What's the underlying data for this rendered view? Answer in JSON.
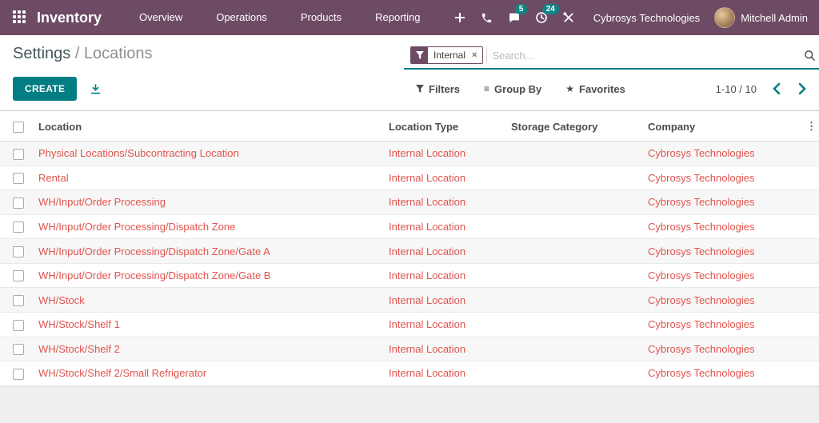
{
  "colors": {
    "brand": "#6e4b64",
    "accent": "#017e84",
    "badge": "#0c8586",
    "record": "#e0544e",
    "breadcrumb": "#44565c"
  },
  "navbar": {
    "app_name": "Inventory",
    "menus": [
      "Overview",
      "Operations",
      "Products",
      "Reporting"
    ],
    "message_badge": "5",
    "activity_badge": "24",
    "company": "Cybrosys Technologies",
    "user": "Mitchell Admin"
  },
  "breadcrumb": {
    "parent": "Settings",
    "separator": " / ",
    "current": "Locations"
  },
  "search": {
    "facet_label": "Internal",
    "facet_remove": "×",
    "placeholder": "Search..."
  },
  "toolbar": {
    "create_label": "CREATE",
    "filters_label": "Filters",
    "group_by_label": "Group By",
    "favorites_label": "Favorites",
    "group_by_glyph": "≡",
    "favorites_glyph": "★",
    "pager_text": "1-10 / 10"
  },
  "table": {
    "columns": [
      "Location",
      "Location Type",
      "Storage Category",
      "Company"
    ],
    "kebab_glyph": "⋮",
    "rows": [
      {
        "location": "Physical Locations/Subcontracting Location",
        "type": "Internal Location",
        "storage_category": "",
        "company": "Cybrosys Technologies"
      },
      {
        "location": "Rental",
        "type": "Internal Location",
        "storage_category": "",
        "company": "Cybrosys Technologies"
      },
      {
        "location": "WH/Input/Order Processing",
        "type": "Internal Location",
        "storage_category": "",
        "company": "Cybrosys Technologies"
      },
      {
        "location": "WH/Input/Order Processing/Dispatch Zone",
        "type": "Internal Location",
        "storage_category": "",
        "company": "Cybrosys Technologies"
      },
      {
        "location": "WH/Input/Order Processing/Dispatch Zone/Gate A",
        "type": "Internal Location",
        "storage_category": "",
        "company": "Cybrosys Technologies"
      },
      {
        "location": "WH/Input/Order Processing/Dispatch Zone/Gate B",
        "type": "Internal Location",
        "storage_category": "",
        "company": "Cybrosys Technologies"
      },
      {
        "location": "WH/Stock",
        "type": "Internal Location",
        "storage_category": "",
        "company": "Cybrosys Technologies"
      },
      {
        "location": "WH/Stock/Shelf 1",
        "type": "Internal Location",
        "storage_category": "",
        "company": "Cybrosys Technologies"
      },
      {
        "location": "WH/Stock/Shelf 2",
        "type": "Internal Location",
        "storage_category": "",
        "company": "Cybrosys Technologies"
      },
      {
        "location": "WH/Stock/Shelf 2/Small Refrigerator",
        "type": "Internal Location",
        "storage_category": "",
        "company": "Cybrosys Technologies"
      }
    ]
  }
}
